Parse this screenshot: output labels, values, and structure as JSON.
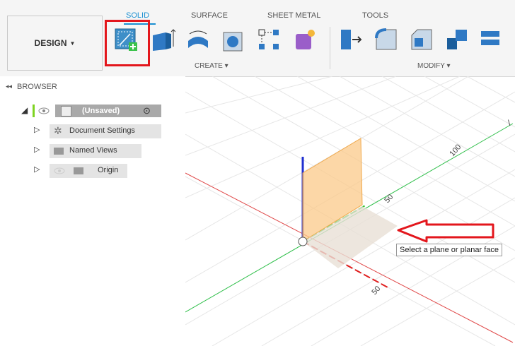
{
  "toolbar": {
    "workspace_label": "DESIGN",
    "tabs": [
      {
        "label": "SOLID",
        "active": true
      },
      {
        "label": "SURFACE",
        "active": false
      },
      {
        "label": "SHEET METAL",
        "active": false
      },
      {
        "label": "TOOLS",
        "active": false
      }
    ],
    "groups": {
      "create": "CREATE ▾",
      "modify": "MODIFY ▾"
    },
    "highlight_color": "#e3161c",
    "accent_color": "#1a8fd1"
  },
  "browser": {
    "title": "BROWSER",
    "root_label": "(Unsaved)",
    "items": [
      {
        "label": "Document Settings",
        "icon": "gear-icon"
      },
      {
        "label": "Named Views",
        "icon": "folder-icon"
      },
      {
        "label": "Origin",
        "icon": "folder-icon"
      }
    ]
  },
  "viewport": {
    "axis_labels": [
      "100",
      "50",
      "50"
    ],
    "tooltip": "Select a plane or planar face"
  }
}
